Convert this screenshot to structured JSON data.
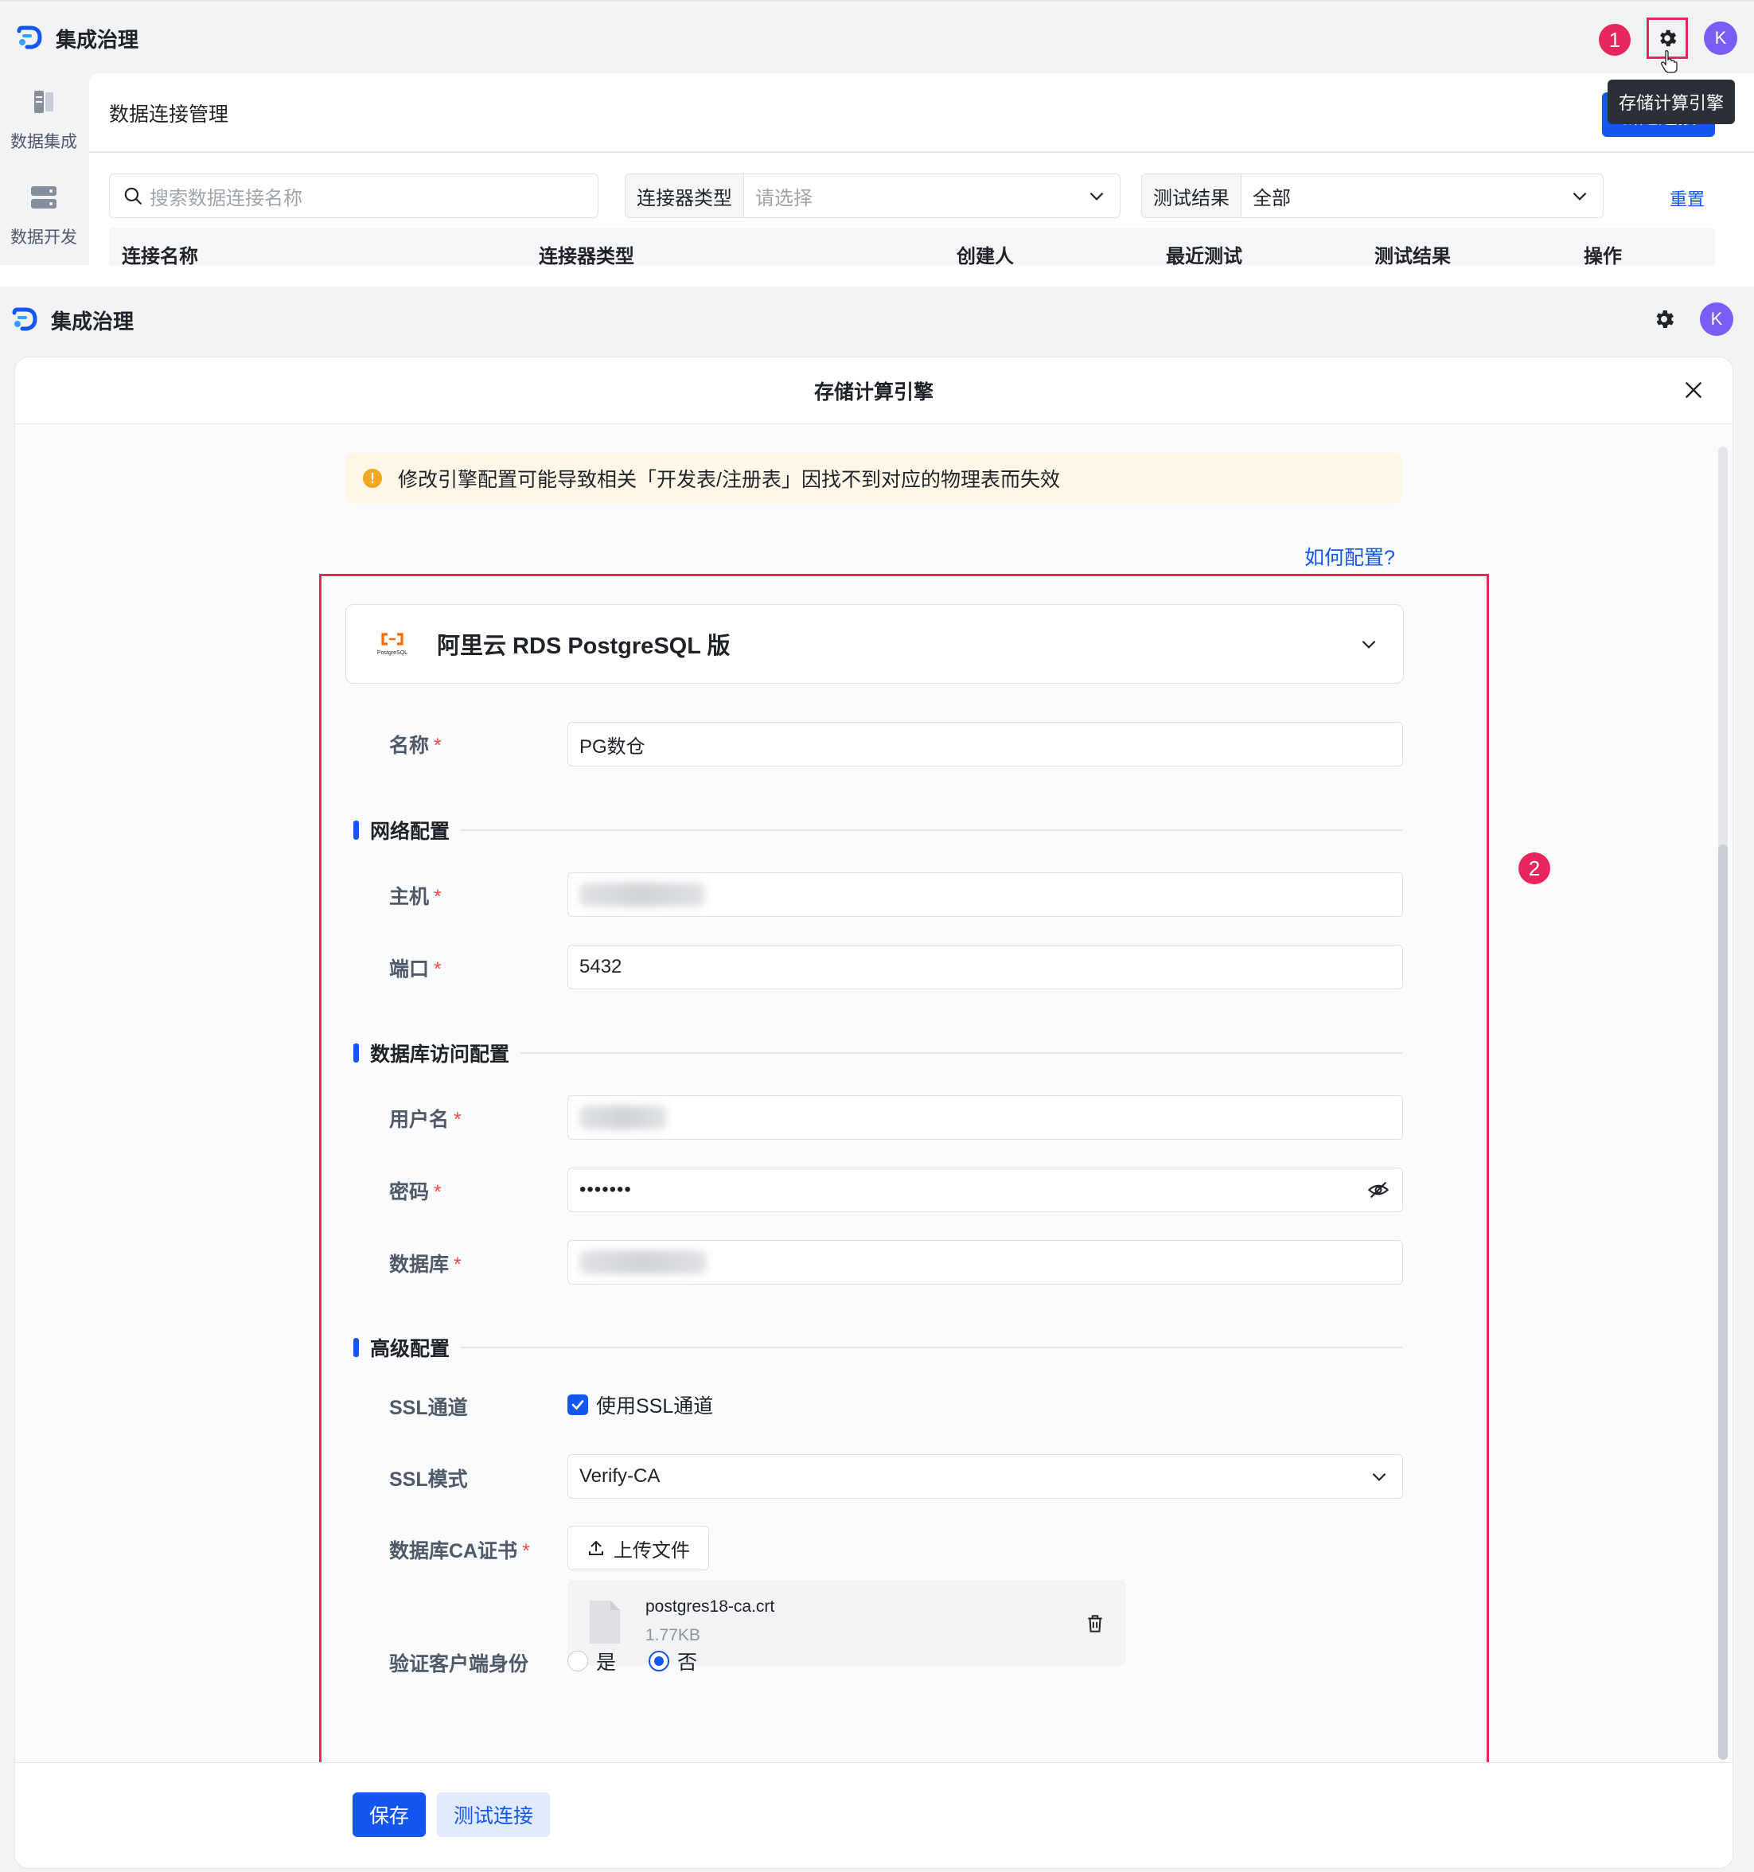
{
  "top": {
    "app_title": "集成治理",
    "marker": "1",
    "avatar_initial": "K",
    "tooltip": "存储计算引擎",
    "sidebar": [
      {
        "label": "数据集成"
      },
      {
        "label": "数据开发"
      }
    ],
    "card_title": "数据连接管理",
    "new_button": "新建连接",
    "search_placeholder": "搜索数据连接名称",
    "connector_type_label": "连接器类型",
    "connector_type_placeholder": "请选择",
    "test_result_label": "测试结果",
    "test_result_value": "全部",
    "reset_link": "重置",
    "table_headers": [
      "连接名称",
      "连接器类型",
      "创建人",
      "最近测试",
      "测试结果",
      "操作"
    ]
  },
  "bottom": {
    "app_title": "集成治理",
    "avatar_initial": "K",
    "modal_title": "存储计算引擎",
    "warning": "修改引擎配置可能导致相关「开发表/注册表」因找不到对应的物理表而失效",
    "help_link": "如何配置?",
    "marker": "2",
    "engine": {
      "logo_text": "PostgreSQL",
      "name": "阿里云 RDS PostgreSQL 版"
    },
    "fields": {
      "name_label": "名称",
      "name_value": "PG数仓",
      "network_section": "网络配置",
      "host_label": "主机",
      "port_label": "端口",
      "port_value": "5432",
      "db_section": "数据库访问配置",
      "user_label": "用户名",
      "password_label": "密码",
      "password_value": "•••••••",
      "database_label": "数据库",
      "advanced_section": "高级配置",
      "ssl_label": "SSL通道",
      "ssl_checkbox_label": "使用SSL通道",
      "ssl_checked": true,
      "ssl_mode_label": "SSL模式",
      "ssl_mode_value": "Verify-CA",
      "ca_label": "数据库CA证书",
      "upload_button": "上传文件",
      "file_name": "postgres18-ca.crt",
      "file_size": "1.77KB",
      "client_auth_label": "验证客户端身份",
      "client_auth_yes": "是",
      "client_auth_no": "否",
      "client_auth_selected": "否"
    },
    "save_button": "保存",
    "test_button": "测试连接"
  },
  "colors": {
    "primary": "#1456f0",
    "highlight": "#e8265e",
    "avatar": "#7b5cf5",
    "warning_bg": "#fef6e7",
    "warning_icon": "#f5a623",
    "required": "#f54a45"
  },
  "icons": [
    "logo-icon",
    "gear-icon",
    "pointer-cursor-icon",
    "data-integration-icon",
    "data-dev-icon",
    "search-icon",
    "chevron-down-icon",
    "close-icon",
    "warning-icon",
    "postgresql-logo-icon",
    "eye-off-icon",
    "check-icon",
    "upload-icon",
    "file-icon",
    "trash-icon"
  ]
}
